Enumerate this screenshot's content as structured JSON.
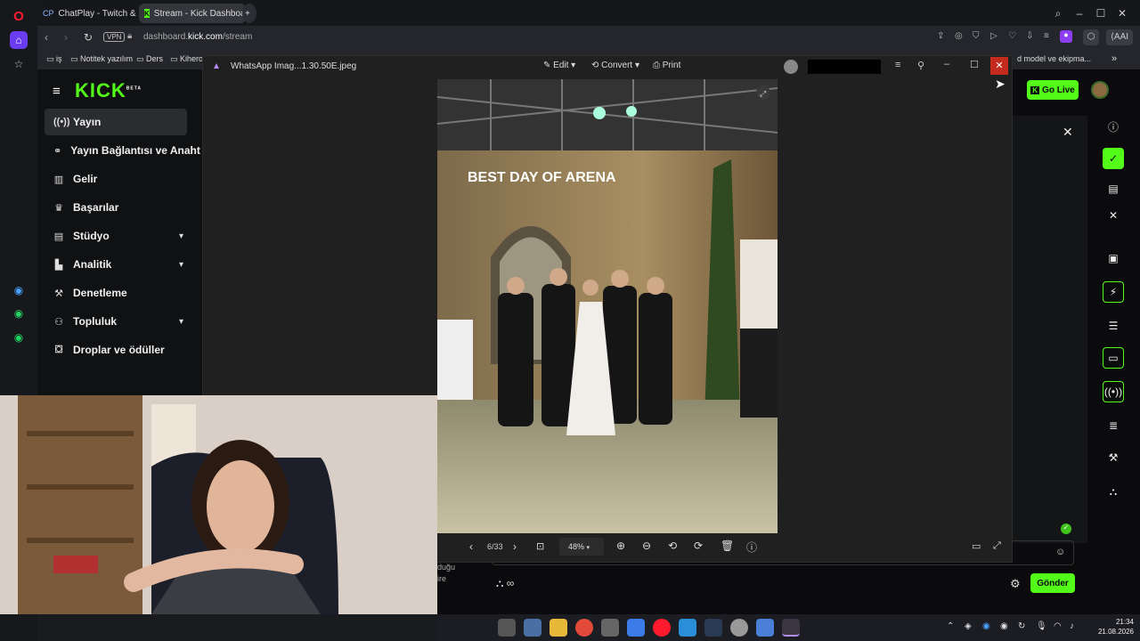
{
  "browser": {
    "tabs": [
      {
        "label": "ChatPlay - Twitch & Kick İ",
        "active": false
      },
      {
        "label": "Stream - Kick Dashboard",
        "active": true
      }
    ],
    "new_tab_symbol": "+",
    "url_prefix": "dashboard.",
    "url_domain": "kick.com",
    "url_path": "/stream",
    "vpn_label": "VPN",
    "ai_label": "AI",
    "bookmarks": [
      {
        "label": "iş",
        "icon": "folder-icon"
      },
      {
        "label": "Notitek yazılım",
        "icon": "folder-icon"
      },
      {
        "label": "Ders",
        "icon": "folder-icon"
      },
      {
        "label": "Kihero",
        "icon": "folder-icon"
      }
    ],
    "bookmark_overflow": "d model ve ekipma..."
  },
  "kick": {
    "logo": "KICK",
    "logo_badge": "BETA",
    "go_live_label": "Go Live",
    "nav": [
      {
        "label": "Yayın",
        "icon": "stream-icon",
        "active": true,
        "expandable": false
      },
      {
        "label": "Yayın Bağlantısı ve Anahta",
        "icon": "link-icon",
        "active": false,
        "expandable": false
      },
      {
        "label": "Gelir",
        "icon": "revenue-icon",
        "active": false,
        "expandable": false
      },
      {
        "label": "Başarılar",
        "icon": "achievement-icon",
        "active": false,
        "expandable": false
      },
      {
        "label": "Stüdyo",
        "icon": "studio-icon",
        "active": false,
        "expandable": true
      },
      {
        "label": "Analitik",
        "icon": "analytics-icon",
        "active": false,
        "expandable": true
      },
      {
        "label": "Denetleme",
        "icon": "moderation-icon",
        "active": false,
        "expandable": false
      },
      {
        "label": "Topluluk",
        "icon": "community-icon",
        "active": false,
        "expandable": true
      },
      {
        "label": "Droplar ve ödüller",
        "icon": "drops-icon",
        "active": false,
        "expandable": false
      }
    ],
    "chat_send_label": "Gönder",
    "chat_partial_1": "duğu",
    "chat_partial_2": "ire",
    "accent": "#53fc18"
  },
  "photos": {
    "filename": "WhatsApp Imag...1.30.50E.jpeg",
    "edit_label": "Edit",
    "convert_label": "Convert",
    "print_label": "Print",
    "image_text": "BEST DAY OF ARENA",
    "counter": "6/33",
    "zoom": "48%"
  },
  "taskbar": {
    "time": "21:34",
    "date": "21.08.2026"
  }
}
